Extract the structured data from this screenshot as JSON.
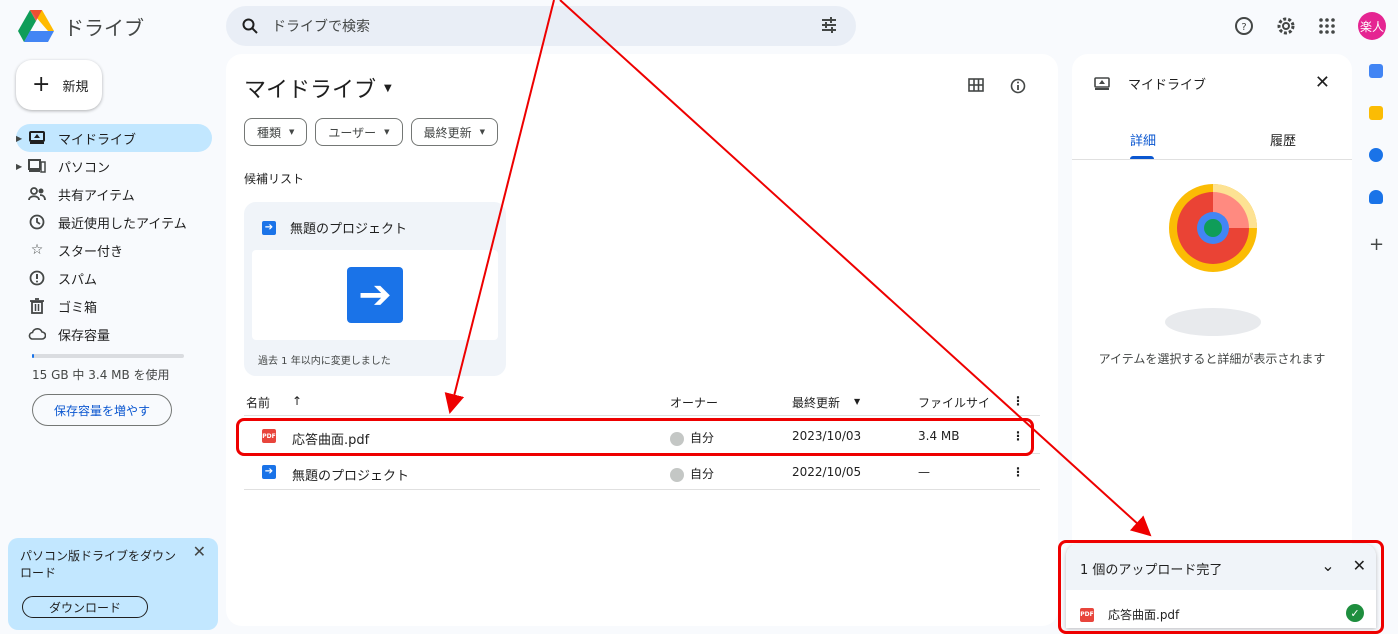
{
  "app": {
    "title": "ドライブ"
  },
  "search": {
    "placeholder": "ドライブで検索"
  },
  "top": {
    "avatar_text": "楽人"
  },
  "new_button": {
    "label": "新規"
  },
  "sidebar": {
    "items": [
      {
        "label": "マイドライブ",
        "icon": "my-drive-icon"
      },
      {
        "label": "パソコン",
        "icon": "computer-icon"
      },
      {
        "label": "共有アイテム",
        "icon": "shared-icon"
      },
      {
        "label": "最近使用したアイテム",
        "icon": "clock-icon"
      },
      {
        "label": "スター付き",
        "icon": "star-icon"
      },
      {
        "label": "スパム",
        "icon": "spam-icon"
      },
      {
        "label": "ゴミ箱",
        "icon": "trash-icon"
      },
      {
        "label": "保存容量",
        "icon": "cloud-icon"
      }
    ],
    "storage_used_fraction": 0.0002,
    "storage_text": "15 GB 中 3.4 MB を使用",
    "storage_button": "保存容量を増やす"
  },
  "promo": {
    "text": "パソコン版ドライブをダウンロード",
    "button": "ダウンロード"
  },
  "main": {
    "title": "マイドライブ",
    "filters": [
      "種類",
      "ユーザー",
      "最終更新"
    ],
    "suggest_label": "候補リスト",
    "suggest_card": {
      "title": "無題のプロジェクト",
      "meta": "過去 1 年以内に変更しました"
    },
    "columns": {
      "name": "名前",
      "owner": "オーナー",
      "modified": "最終更新",
      "size": "ファイルサイ"
    },
    "rows": [
      {
        "name": "応答曲面.pdf",
        "owner": "自分",
        "modified": "2023/10/03",
        "size": "3.4 MB",
        "type": "pdf"
      },
      {
        "name": "無題のプロジェクト",
        "owner": "自分",
        "modified": "2022/10/05",
        "size": "—",
        "type": "project"
      }
    ]
  },
  "details": {
    "title": "マイドライブ",
    "tabs": [
      "詳細",
      "履歴"
    ],
    "message": "アイテムを選択すると詳細が表示されます"
  },
  "upload": {
    "title": "1 個のアップロード完了",
    "file": "応答曲面.pdf"
  },
  "colors": {
    "annotation": "#ee0000",
    "accent": "#0b57d0",
    "pdf": "#e8453c"
  }
}
